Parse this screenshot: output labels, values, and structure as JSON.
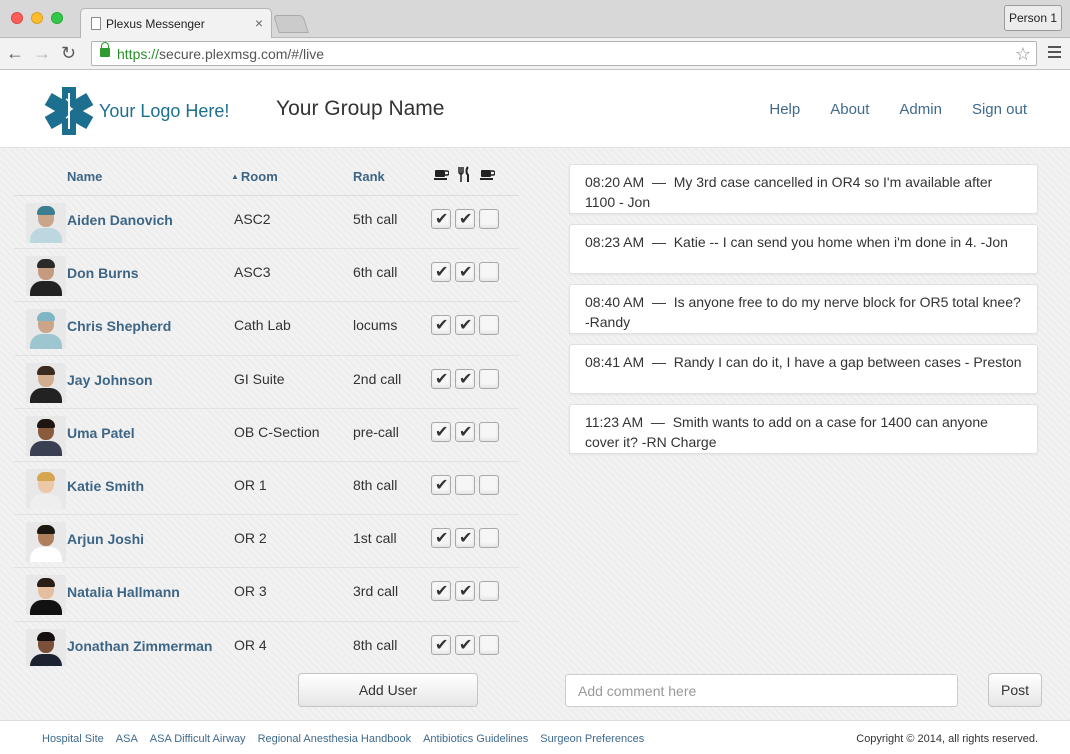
{
  "browser": {
    "tab_title": "Plexus Messenger",
    "tab_close": "×",
    "profile_button": "Person 1",
    "url_scheme": "https://",
    "url_rest": "secure.plexmsg.com/#/live",
    "icons": [
      "back-arrow-icon",
      "forward-arrow-icon",
      "reload-icon",
      "lock-icon",
      "bookmark-star-icon",
      "menu-icon"
    ]
  },
  "header": {
    "logo_text": "Your Logo Here!",
    "group_name": "Your Group Name",
    "nav": [
      "Help",
      "About",
      "Admin",
      "Sign out"
    ]
  },
  "table": {
    "columns": {
      "name": "Name",
      "room": "Room",
      "rank": "Rank",
      "sort_indicator": "▲"
    },
    "column_icons": [
      "coffee-cup-icon",
      "fork-knife-icon",
      "coffee-cup-icon"
    ],
    "rows": [
      {
        "name": "Aiden Danovich",
        "room": "ASC2",
        "rank": "5th call",
        "checks": [
          true,
          true,
          false
        ]
      },
      {
        "name": "Don Burns",
        "room": "ASC3",
        "rank": "6th call",
        "checks": [
          true,
          true,
          false
        ]
      },
      {
        "name": "Chris Shepherd",
        "room": "Cath Lab",
        "rank": "locums",
        "checks": [
          true,
          true,
          false
        ]
      },
      {
        "name": "Jay Johnson",
        "room": "GI Suite",
        "rank": "2nd call",
        "checks": [
          true,
          true,
          false
        ]
      },
      {
        "name": "Uma Patel",
        "room": "OB C-Section",
        "rank": "pre-call",
        "checks": [
          true,
          true,
          false
        ]
      },
      {
        "name": "Katie Smith",
        "room": "OR 1",
        "rank": "8th call",
        "checks": [
          true,
          false,
          false
        ]
      },
      {
        "name": "Arjun Joshi",
        "room": "OR 2",
        "rank": "1st call",
        "checks": [
          true,
          true,
          false
        ]
      },
      {
        "name": "Natalia Hallmann",
        "room": "OR 3",
        "rank": "3rd call",
        "checks": [
          true,
          true,
          false
        ]
      },
      {
        "name": "Jonathan Zimmerman",
        "room": "OR 4",
        "rank": "8th call",
        "checks": [
          true,
          true,
          false
        ]
      }
    ],
    "add_user_label": "Add User"
  },
  "messages": [
    {
      "time": "08:20 AM",
      "text": "My 3rd case cancelled in OR4 so I'm available after 1100 - Jon"
    },
    {
      "time": "08:23 AM",
      "text": "Katie -- I can send you home when i'm done in 4. -Jon"
    },
    {
      "time": "08:40 AM",
      "text": "Is anyone free to do my nerve block for OR5 total knee? -Randy"
    },
    {
      "time": "08:41 AM",
      "text": "Randy I can do it, I have a gap between cases - Preston"
    },
    {
      "time": "11:23 AM",
      "text": "Smith wants to add on a case for 1400 can anyone cover it? -RN Charge"
    }
  ],
  "message_separator": "—",
  "composer": {
    "placeholder": "Add comment here",
    "value": "",
    "post_label": "Post"
  },
  "footer": {
    "links": [
      "Hospital Site",
      "ASA",
      "ASA Difficult Airway",
      "Regional Anesthesia Handbook",
      "Antibiotics Guidelines",
      "Surgeon Preferences"
    ],
    "copyright": "Copyright © 2014, all rights reserved."
  },
  "colors": {
    "link": "#3f6a8c",
    "logo": "#1c6f8e",
    "https_green": "#2a8e2a"
  }
}
